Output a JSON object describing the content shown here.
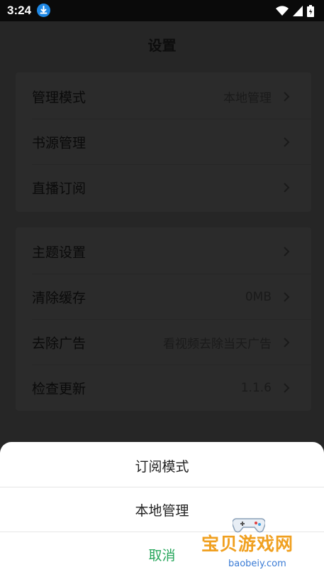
{
  "status_bar": {
    "time": "3:24"
  },
  "header": {
    "title": "设置"
  },
  "settings": {
    "group1": [
      {
        "label": "管理模式",
        "value": "本地管理"
      },
      {
        "label": "书源管理",
        "value": ""
      },
      {
        "label": "直播订阅",
        "value": ""
      }
    ],
    "group2": [
      {
        "label": "主题设置",
        "value": ""
      },
      {
        "label": "清除缓存",
        "value": "0MB"
      },
      {
        "label": "去除广告",
        "value": "看视频去除当天广告"
      },
      {
        "label": "检查更新",
        "value": "1.1.6"
      }
    ]
  },
  "action_sheet": {
    "options": [
      "订阅模式",
      "本地管理"
    ],
    "cancel": "取消",
    "cancel_color": "#26a65b"
  },
  "watermark": {
    "text": "宝贝游戏网",
    "sub": "baobeiy.com"
  }
}
